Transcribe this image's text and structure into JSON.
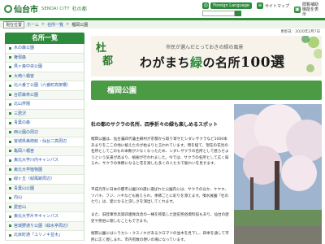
{
  "header": {
    "city_name": "仙台市",
    "brand_sub": "SENDAI CITY",
    "brand_tail": "杜の都",
    "language_button": "Foreign Language",
    "search_placeholder": "",
    "sitemap_label": "サイトマップ",
    "trash_label": "閲覧補助機能を表示"
  },
  "breadcrumbs": {
    "current_tag": "現在位置",
    "items": [
      "ホーム",
      "名所一覧",
      "榴岡公園"
    ]
  },
  "update_text": "更新日：2020年2月7日",
  "sidebar": {
    "title": "名所一覧",
    "items": [
      "水の森公園",
      "権現森",
      "貝ヶ森中央公園",
      "大崎八幡宮",
      "北六番丁公園（六番町高架橋）",
      "台原森林公園",
      "北山界隈",
      "三居沢",
      "青葉の森",
      "西公園の周辺",
      "宮城県美術館・仙台二高周辺",
      "亀岡八幡宮",
      "東北大学川内キャンパス",
      "東北大学植物園",
      "緑ヶ丘（緑風跡周辺）",
      "青葉山公園",
      "向山",
      "愛宕山",
      "東北大学片平キャンパス",
      "宮城野通り公園（緑水亭周辺）",
      "北目町通「ユリノキ並木」"
    ]
  },
  "banner": {
    "logo_char_1": "杜",
    "logo_char_2": "都",
    "subtitle": "市民が選んだとっておきの緑の風景",
    "title_part1": "わがまち",
    "title_green": "緑",
    "title_part2": "の名所",
    "title_number": "100選"
  },
  "page_title": "榴岡公園",
  "article": {
    "subheading": "杜の都のサクラの名所、四季折々の緑も楽しめるスポット",
    "paragraphs": [
      "榴岡公園は、仙台藩四代藩主綱村が京都から取り寄せたシダレザクラなど1000本あまりをここの地に植えたのが始まりと言われています。時を経て、現在の花見の名所としてこのもの本数が少なくなったため、シダレザクラの名所として甦らせようという気運が高まり、植樹が行われました。今では、サクラの名所として広く知られ、サクラの季節になると花を楽しむ多くの人たちで賑わいを見せます。",
      "平成元年に日本の都市公園100選に選ばれた公園内には、サクラのほか、ケヤキ、ツバキ、フジ、ハギなども植えられ、季節ごとに彩りを添えます。噴水展園「杜の七り」は、愛になると涼しさを演出してくれます。",
      "また、旧陸軍歩兵第四連隊兵舎の一棟を移築した歴史民俗資料館もあり、仙台の歴史や民俗に親しむこともできます。",
      "榴岡公園にはシラカシ・クスノキがあるクロマツの並木を見下し、四季を通して市民に広く親しまれ、市内有数の憩いの場になっています。"
    ]
  },
  "colors": {
    "brand_green": "#2e8b3d",
    "heading_green": "#4b9a44",
    "link_blue": "#2a5aa8"
  }
}
